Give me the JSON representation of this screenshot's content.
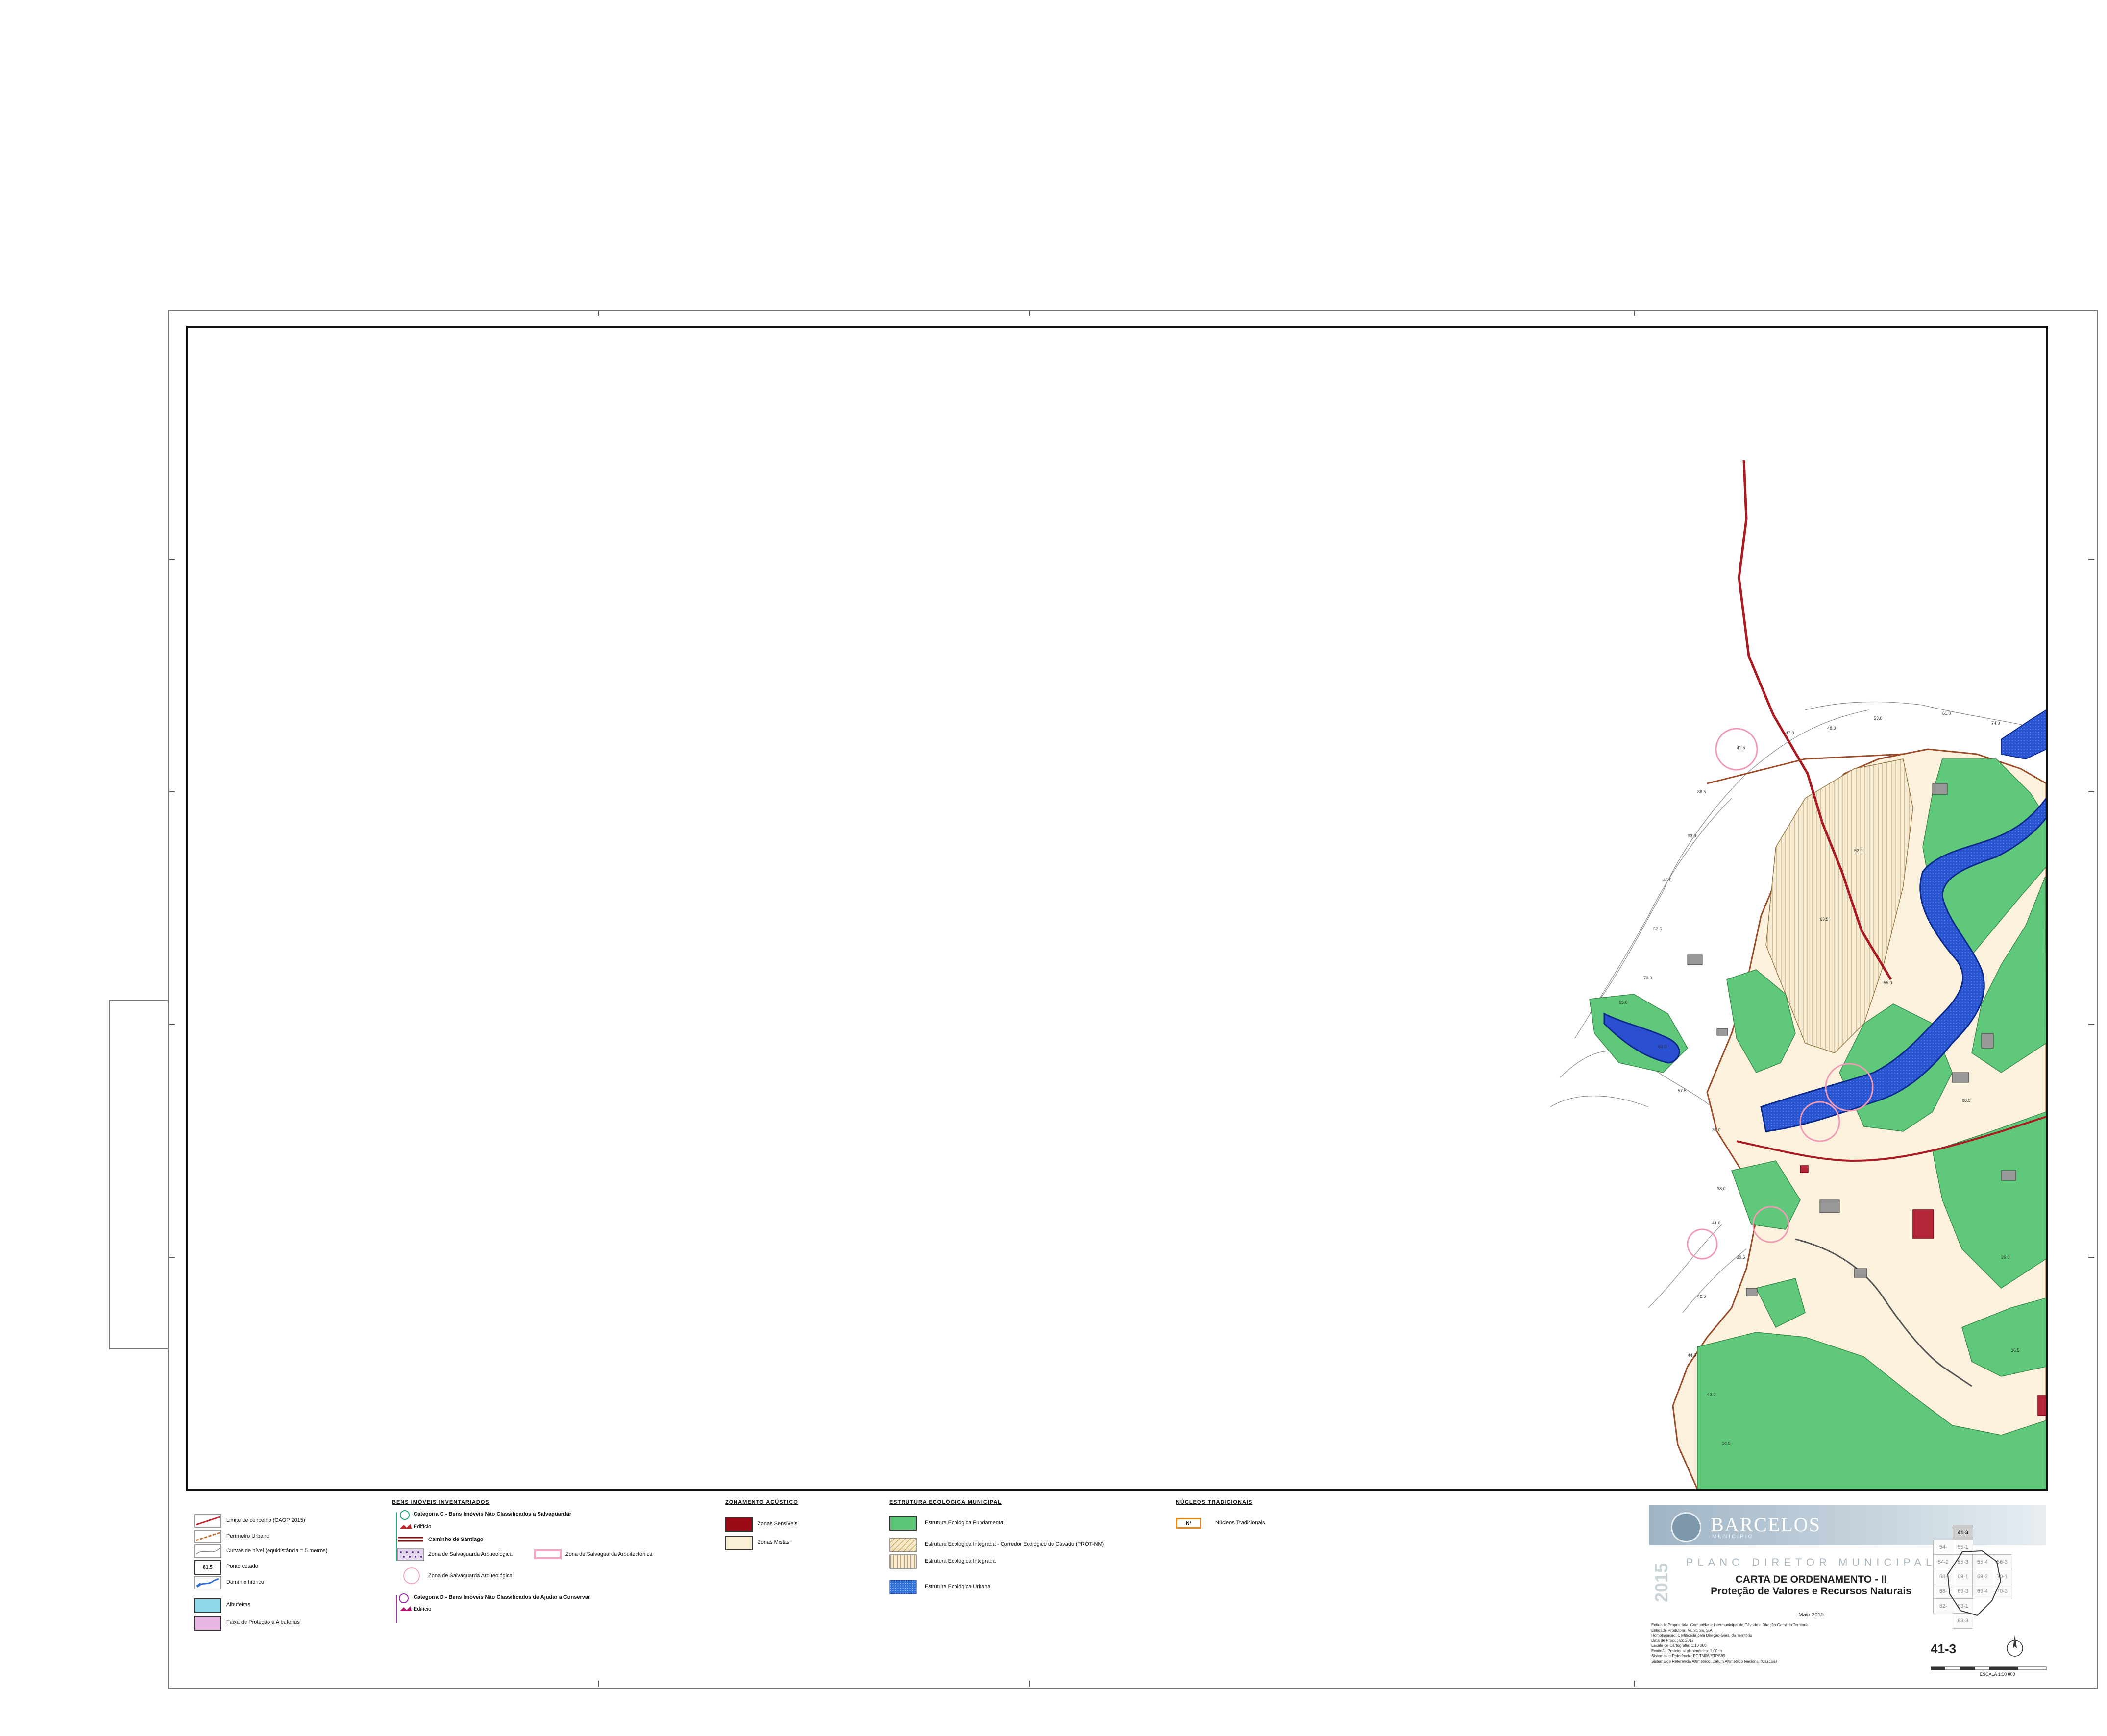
{
  "legend": {
    "col1": {
      "items": [
        {
          "label": "Limite de concelho (CAOP 2015)"
        },
        {
          "label": "Perímetro Urbano"
        },
        {
          "label": "Curvas de nível",
          "note": "(equidistância = 5 metros)"
        },
        {
          "label": "Ponto cotado",
          "symbol": "81.5"
        },
        {
          "label": "Domínio hídrico"
        },
        {
          "label": "Albufeiras"
        },
        {
          "label": "Faixa de Proteção a Albufeiras"
        }
      ]
    },
    "col2": {
      "heading": "BENS IMÓVEIS INVENTARIADOS",
      "cat_c": "Categoria C - Bens Imóveis Não Classificados a Salvaguardar",
      "edificio_c": "Edifício",
      "caminho": "Caminho de Santiago",
      "zona_arq": "Zona de Salvaguarda Arqueológica",
      "zona_arqt": "Zona de Salvaguarda Arquitectónica",
      "zona_arq2": "Zona de Salvaguarda Arqueológica",
      "cat_d": "Categoria D - Bens Imóveis Não Classificados de Ajudar a Conservar",
      "edificio_d": "Edifício"
    },
    "col3": {
      "heading": "ZONAMENTO ACÚSTICO",
      "items": [
        {
          "label": "Zonas Sensíveis",
          "color": "#9b0a14"
        },
        {
          "label": "Zonas Mistas",
          "color": "#fbefd6"
        }
      ]
    },
    "col4": {
      "heading": "ESTRUTURA ECOLÓGICA MUNICIPAL",
      "items": [
        {
          "label": "Estrutura Ecológica Fundamental",
          "color": "#5cc877"
        },
        {
          "label": "Estrutura Ecológica Integrada - Corredor Ecológico do Cávado (PROT-NM)",
          "color": "#f3e3b8"
        },
        {
          "label": "Estrutura Ecológica Integrada",
          "color": "#efe0c0"
        },
        {
          "label": "Estrutura Ecológica Urbana",
          "color": "#2f6fd6"
        }
      ]
    },
    "col5": {
      "heading": "NÚCLEOS TRADICIONAIS",
      "symbol": "N°",
      "label": "Núcleos Tradicionais"
    }
  },
  "title_block": {
    "brand": "BARCELOS",
    "brand_sub": "MUNICÍPIO",
    "year": "2015",
    "plan": "PLANO DIRETOR MUNICIPAL",
    "title": "CARTA DE ORDENAMENTO - II",
    "subtitle": "Proteção de Valores e Recursos Naturais",
    "date": "Maio 2015",
    "fine_print": [
      "Entidade Proprietária: Comunidade Intermunicipal do Cávado e Direção Geral do Território",
      "Entidade Produtora: Municipia, S.A.",
      "Homologação: Certificada pela Direção-Geral do Território",
      "Data de Produção: 2012",
      "Escala de Cartografia: 1:10 000",
      "Exatidão Posicional planimétrica: 1,00 m",
      "Sistema de Referência: PT-TM06/ETRS89",
      "Sistema de Referência Altimétrico: Datum Altimétrico Nacional (Cascais)"
    ],
    "sheet": "41-3",
    "scale": "ESCALA 1:10 000",
    "index_grid": [
      [
        "41-3"
      ],
      [
        "54-",
        "55-1",
        "",
        ""
      ],
      [
        "54-2",
        "55-3",
        "55-4",
        "56-3"
      ],
      [
        "68-",
        "69-1",
        "69-2",
        "70-1"
      ],
      [
        "68-",
        "69-3",
        "69-4",
        "70-3"
      ],
      [
        "82-",
        "83-1",
        "",
        ""
      ],
      [
        "",
        "83-3",
        "",
        ""
      ]
    ]
  },
  "map_labels": [
    "41.5",
    "47.0",
    "48.0",
    "53.0",
    "61.0",
    "74.0",
    "88.5",
    "93.0",
    "45.5",
    "52.5",
    "73.0",
    "65.0",
    "60.0",
    "57.5",
    "37.0",
    "38.0",
    "41.0",
    "39.5",
    "42.5",
    "44.0",
    "43.0",
    "58.5",
    "52.0",
    "63.5",
    "55.0",
    "68.5",
    "39.0",
    "36.5"
  ]
}
